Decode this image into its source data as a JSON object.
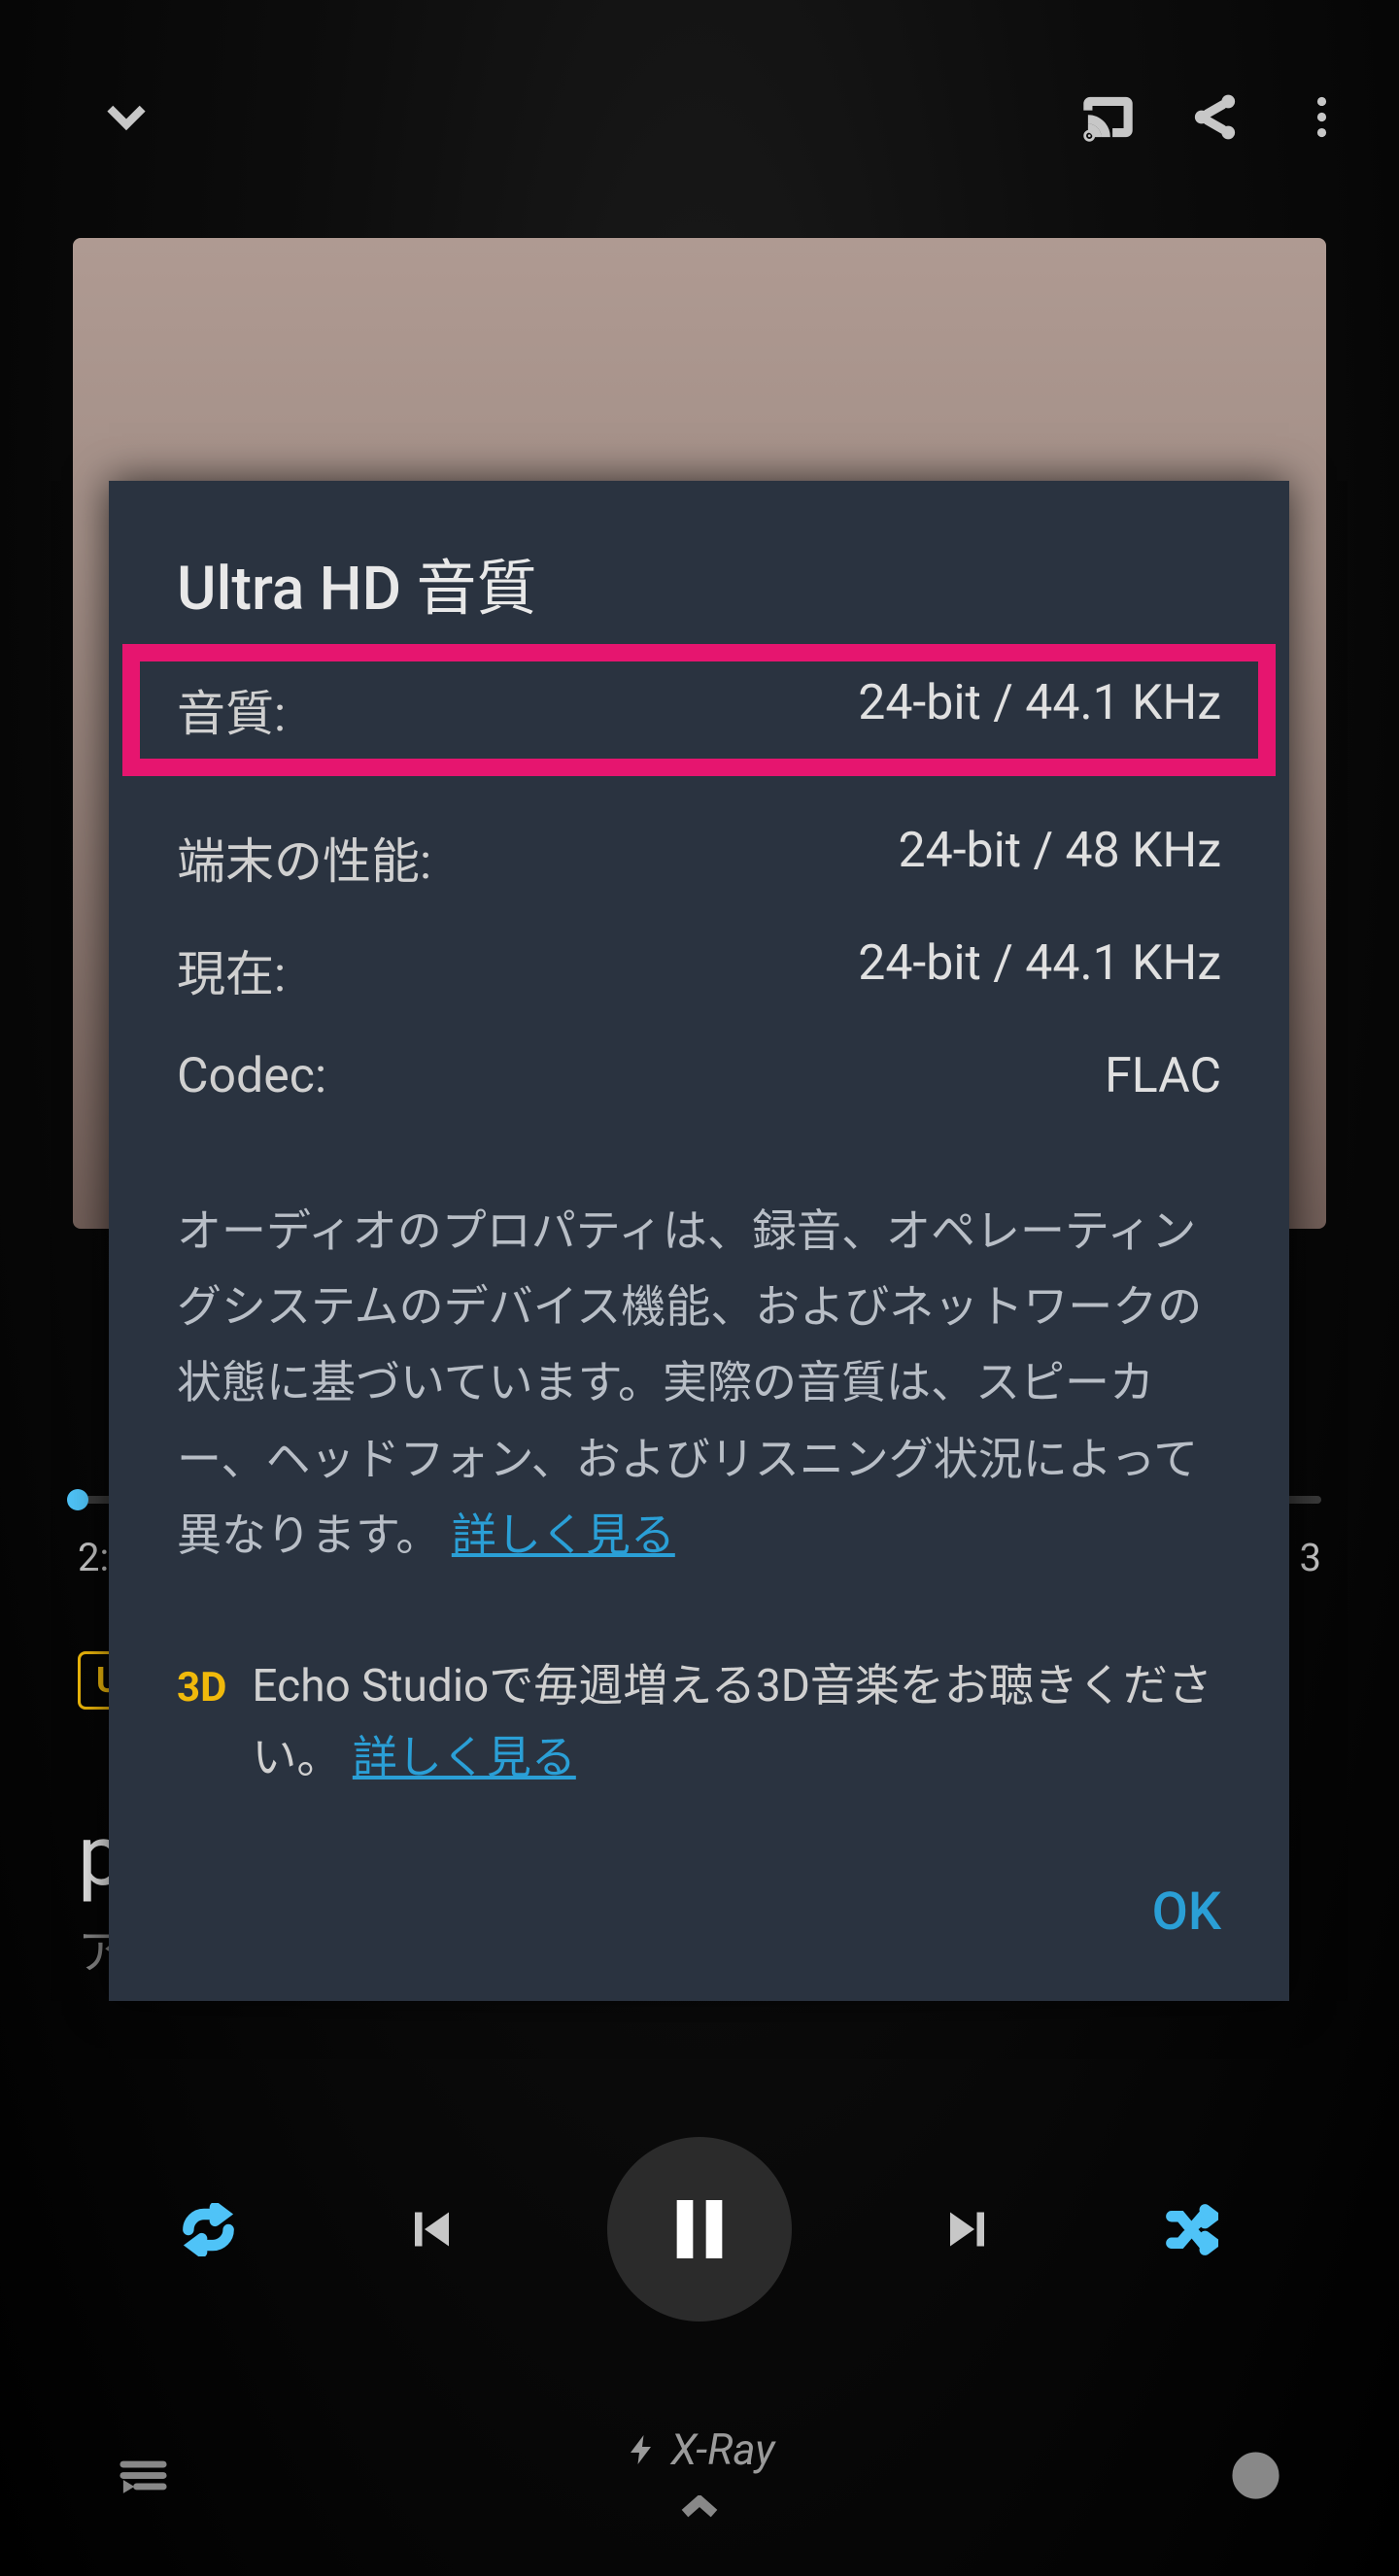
{
  "appbar": {
    "cast": "Cast",
    "share": "Share",
    "menu": "More"
  },
  "player": {
    "time_left": "2:",
    "time_right": "3",
    "badge": "U",
    "track_title": "p",
    "track_artist": "ア",
    "xray": "X-Ray"
  },
  "dialog": {
    "title": "Ultra HD 音質",
    "rows": [
      {
        "label": "音質:",
        "value": "24-bit / 44.1 KHz"
      },
      {
        "label": "端末の性能:",
        "value": "24-bit / 48 KHz"
      },
      {
        "label": "現在:",
        "value": "24-bit / 44.1 KHz"
      },
      {
        "label": "Codec:",
        "value": "FLAC"
      }
    ],
    "desc": "オーディオのプロパティは、録音、オペレーティングシステムのデバイス機能、およびネットワークの状態に基づいています。実際の音質は、スピーカー、ヘッドフォン、およびリスニング状況によって異なります。 ",
    "desc_link": "詳しく見る",
    "promo_badge": "3D",
    "promo_text": "Echo Studioで毎週増える3D音楽をお聴きください。 ",
    "promo_link": "詳しく見る",
    "ok": "OK"
  }
}
